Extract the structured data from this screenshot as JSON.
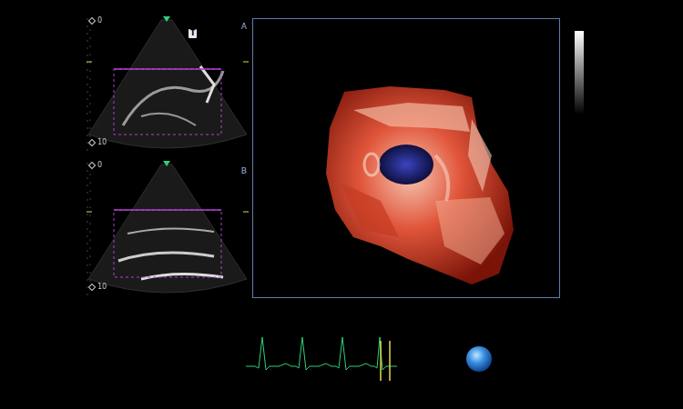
{
  "views": [
    {
      "label": "A",
      "depth_start": "0",
      "depth_end": "10",
      "badge": "T"
    },
    {
      "label": "B",
      "depth_start": "0",
      "depth_end": "10"
    }
  ]
}
